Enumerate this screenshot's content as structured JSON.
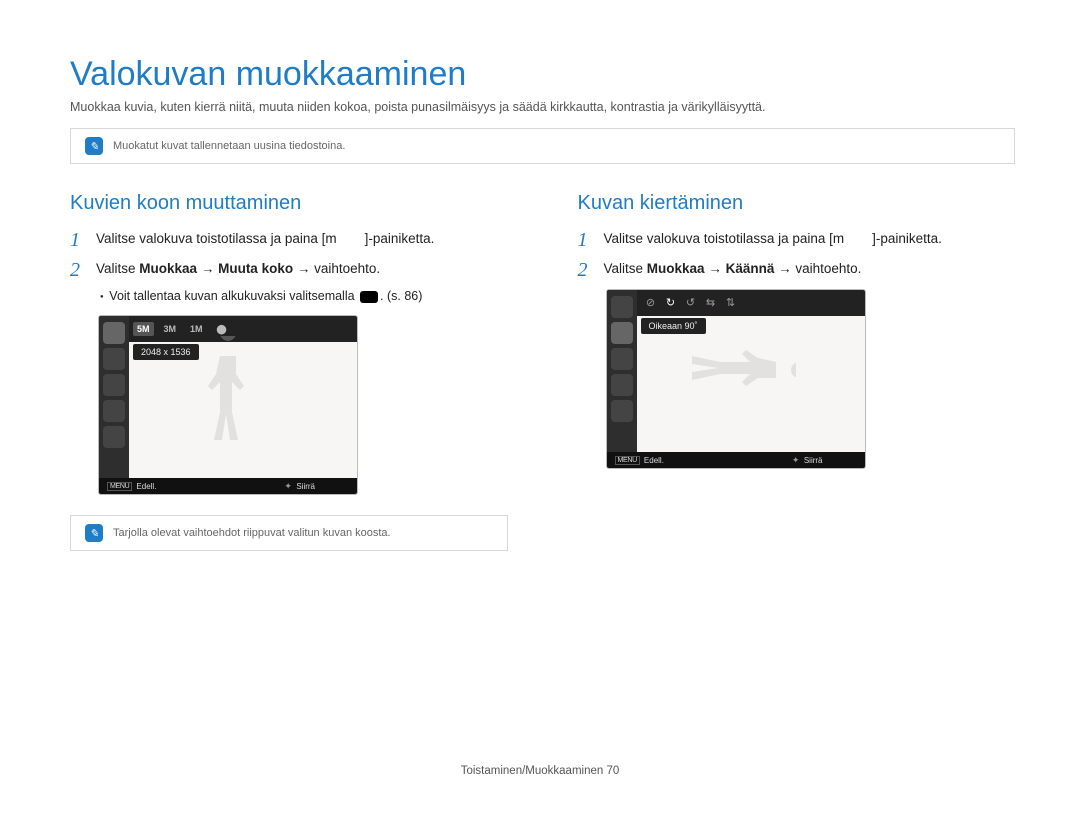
{
  "page": {
    "title": "Valokuvan muokkaaminen",
    "desc": "Muokkaa kuvia, kuten kierrä niitä, muuta niiden kokoa, poista punasilmäisyys ja säädä kirkkautta, kontrastia ja värikylläisyyttä."
  },
  "note_top": "Muokatut kuvat tallennetaan uusina tiedostoina.",
  "left": {
    "heading": "Kuvien koon muuttaminen",
    "step1_pre": "Valitse valokuva toistotilassa ja paina [",
    "step1_key": "m",
    "step1_post": "]-painiketta.",
    "step2_pre": "Valitse ",
    "step2_b1": "Muokkaa",
    "step2_arr": " → ",
    "step2_b2": "Muuta koko",
    "step2_b3": " vaihtoehto.",
    "bullet": "Voit tallentaa kuvan alkukuvaksi valitsemalla ",
    "bullet_post": ". (s. 86)",
    "screenshot": {
      "top_items": [
        "5M",
        "3M",
        "1M",
        ""
      ],
      "label": "2048 x 1536",
      "bottom_menu": "MENU",
      "bottom_back": "Edell.",
      "bottom_move": "Siirrä"
    },
    "note_bottom": "Tarjolla olevat vaihtoehdot riippuvat valitun kuvan koosta."
  },
  "right": {
    "heading": "Kuvan kiertäminen",
    "step1_pre": "Valitse valokuva toistotilassa ja paina [",
    "step1_key": "m",
    "step1_post": "]-painiketta.",
    "step2_pre": "Valitse ",
    "step2_b1": "Muokkaa",
    "step2_arr": " → ",
    "step2_b2": "Käännä",
    "step2_b3": " vaihtoehto.",
    "screenshot": {
      "label": "Oikeaan 90˚",
      "bottom_menu": "MENU",
      "bottom_back": "Edell.",
      "bottom_move": "Siirrä"
    }
  },
  "footer": "Toistaminen/Muokkaaminen  70"
}
